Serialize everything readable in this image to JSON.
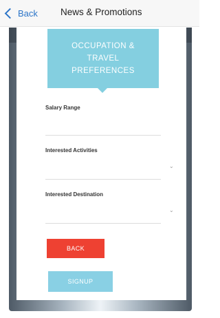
{
  "nav": {
    "back_label": "Back",
    "title": "News & Promotions"
  },
  "form": {
    "header_lines": [
      "OCCUPATION &",
      "TRAVEL",
      "PREFERENCES"
    ],
    "fields": [
      {
        "label": "Salary Range",
        "type": "text"
      },
      {
        "label": "Interested Activities",
        "type": "select",
        "caret": "⌄"
      },
      {
        "label": "Interested Destination",
        "type": "select",
        "caret": "⌄"
      }
    ],
    "back_button": "BACK",
    "signup_button": "SIGNUP"
  },
  "colors": {
    "accent_blue": "#84cfe0",
    "back_red": "#ee4132",
    "nav_link": "#2c75c8"
  }
}
